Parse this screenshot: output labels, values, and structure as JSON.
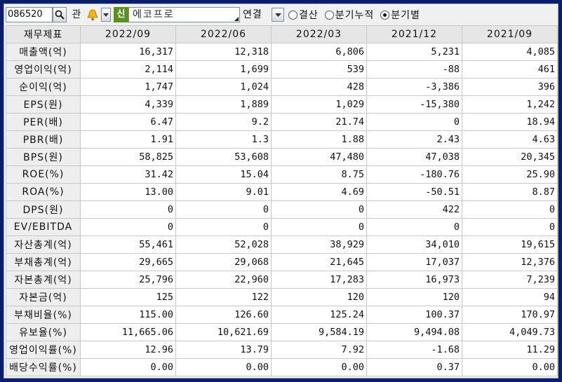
{
  "toolbar": {
    "stock_code": "086520",
    "gwan_label": "관",
    "new_badge": "신",
    "company_name": "에코프로",
    "consolidation": "연결",
    "radios": [
      {
        "label": "결산",
        "selected": false
      },
      {
        "label": "분기누적",
        "selected": false
      },
      {
        "label": "분기별",
        "selected": true
      }
    ]
  },
  "table": {
    "corner_header": "재무제표",
    "columns": [
      "2022/09",
      "2022/06",
      "2022/03",
      "2021/12",
      "2021/09"
    ],
    "rows": [
      {
        "label": "매출액(억)",
        "values": [
          "16,317",
          "12,318",
          "6,806",
          "5,231",
          "4,085"
        ]
      },
      {
        "label": "영업이익(억)",
        "values": [
          "2,114",
          "1,699",
          "539",
          "-88",
          "461"
        ]
      },
      {
        "label": "순이익(억)",
        "values": [
          "1,747",
          "1,024",
          "428",
          "-3,386",
          "396"
        ]
      },
      {
        "label": "EPS(원)",
        "values": [
          "4,339",
          "1,889",
          "1,029",
          "-15,380",
          "1,242"
        ]
      },
      {
        "label": "PER(배)",
        "values": [
          "6.47",
          "9.2",
          "21.74",
          "0",
          "18.94"
        ]
      },
      {
        "label": "PBR(배)",
        "values": [
          "1.91",
          "1.3",
          "1.88",
          "2.43",
          "4.63"
        ]
      },
      {
        "label": "BPS(원)",
        "values": [
          "58,825",
          "53,608",
          "47,480",
          "47,038",
          "20,345"
        ]
      },
      {
        "label": "ROE(%)",
        "values": [
          "31.42",
          "15.04",
          "8.75",
          "-180.76",
          "25.90"
        ]
      },
      {
        "label": "ROA(%)",
        "values": [
          "13.00",
          "9.01",
          "4.69",
          "-50.51",
          "8.87"
        ]
      },
      {
        "label": "DPS(원)",
        "values": [
          "0",
          "0",
          "0",
          "422",
          "0"
        ]
      },
      {
        "label": "EV/EBITDA",
        "values": [
          "0",
          "0",
          "0",
          "0",
          "0"
        ]
      },
      {
        "label": "자산총계(억)",
        "values": [
          "55,461",
          "52,028",
          "38,929",
          "34,010",
          "19,615"
        ]
      },
      {
        "label": "부채총계(억)",
        "values": [
          "29,665",
          "29,068",
          "21,645",
          "17,037",
          "12,376"
        ]
      },
      {
        "label": "자본총계(억)",
        "values": [
          "25,796",
          "22,960",
          "17,283",
          "16,973",
          "7,239"
        ]
      },
      {
        "label": "자본금(억)",
        "values": [
          "125",
          "122",
          "120",
          "120",
          "94"
        ]
      },
      {
        "label": "부채비율(%)",
        "values": [
          "115.00",
          "126.60",
          "125.24",
          "100.37",
          "170.97"
        ]
      },
      {
        "label": "유보율(%)",
        "values": [
          "11,665.06",
          "10,621.69",
          "9,584.19",
          "9,494.08",
          "4,049.73"
        ]
      },
      {
        "label": "영업이익률(%)",
        "values": [
          "12.96",
          "13.79",
          "7.92",
          "-1.68",
          "11.29"
        ]
      },
      {
        "label": "배당수익률(%)",
        "values": [
          "0.00",
          "0.00",
          "0.00",
          "0.37",
          "0.00"
        ]
      }
    ]
  }
}
